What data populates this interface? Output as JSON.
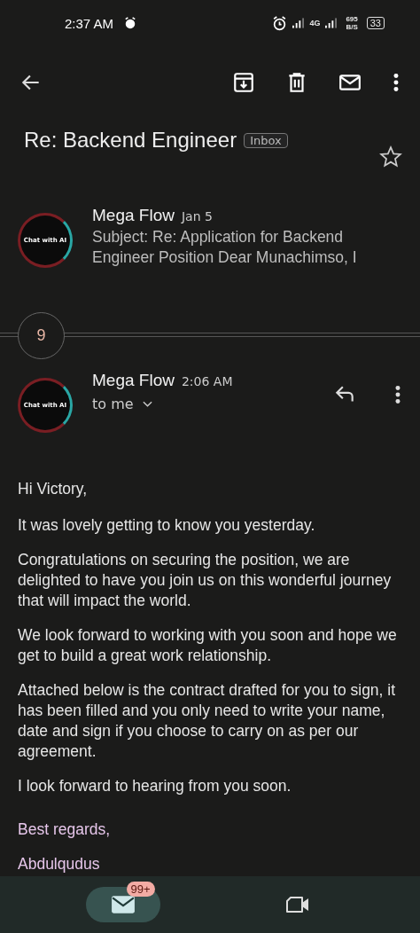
{
  "status_bar": {
    "time": "2:37 AM",
    "network": "4G",
    "speed_value": "695",
    "speed_unit": "B/S",
    "battery": "33"
  },
  "subject": {
    "title": "Re: Backend Engineer",
    "label": "Inbox",
    "starred": false
  },
  "collapsed_message": {
    "avatar_text": "Chat with AI",
    "sender": "Mega Flow",
    "date": "Jan 5",
    "snippet": "Subject: Re: Application for Backend Engineer Position Dear Munachimso, I"
  },
  "hidden_count": "9",
  "message": {
    "avatar_text": "Chat with AI",
    "sender": "Mega Flow",
    "time": "2:06 AM",
    "recipient": "to me",
    "body": [
      {
        "text": "Hi Victory,",
        "kind": "plain"
      },
      {
        "text": "It was lovely getting to know you yesterday.",
        "kind": "plain"
      },
      {
        "text": "Congratulations on securing the position, we are delighted to have you join us on this wonderful journey that will impact the world.",
        "kind": "plain"
      },
      {
        "text": "We look forward to working with you soon and hope we get to build a great work relationship.",
        "kind": "plain"
      },
      {
        "text": "Attached below is the contract drafted for you to sign, it has been filled and you only need to write your name, date and sign if you choose to carry on as per our agreement.",
        "kind": "plain"
      },
      {
        "text": "I look forward to hearing from you soon.",
        "kind": "plain"
      },
      {
        "text": "Best regards,",
        "kind": "signature"
      },
      {
        "text": "Abdulqudus",
        "kind": "signature"
      }
    ]
  },
  "bottom_nav": [
    {
      "kind": "mail",
      "badge": "99+",
      "selected": true
    },
    {
      "kind": "video",
      "selected": false
    }
  ]
}
